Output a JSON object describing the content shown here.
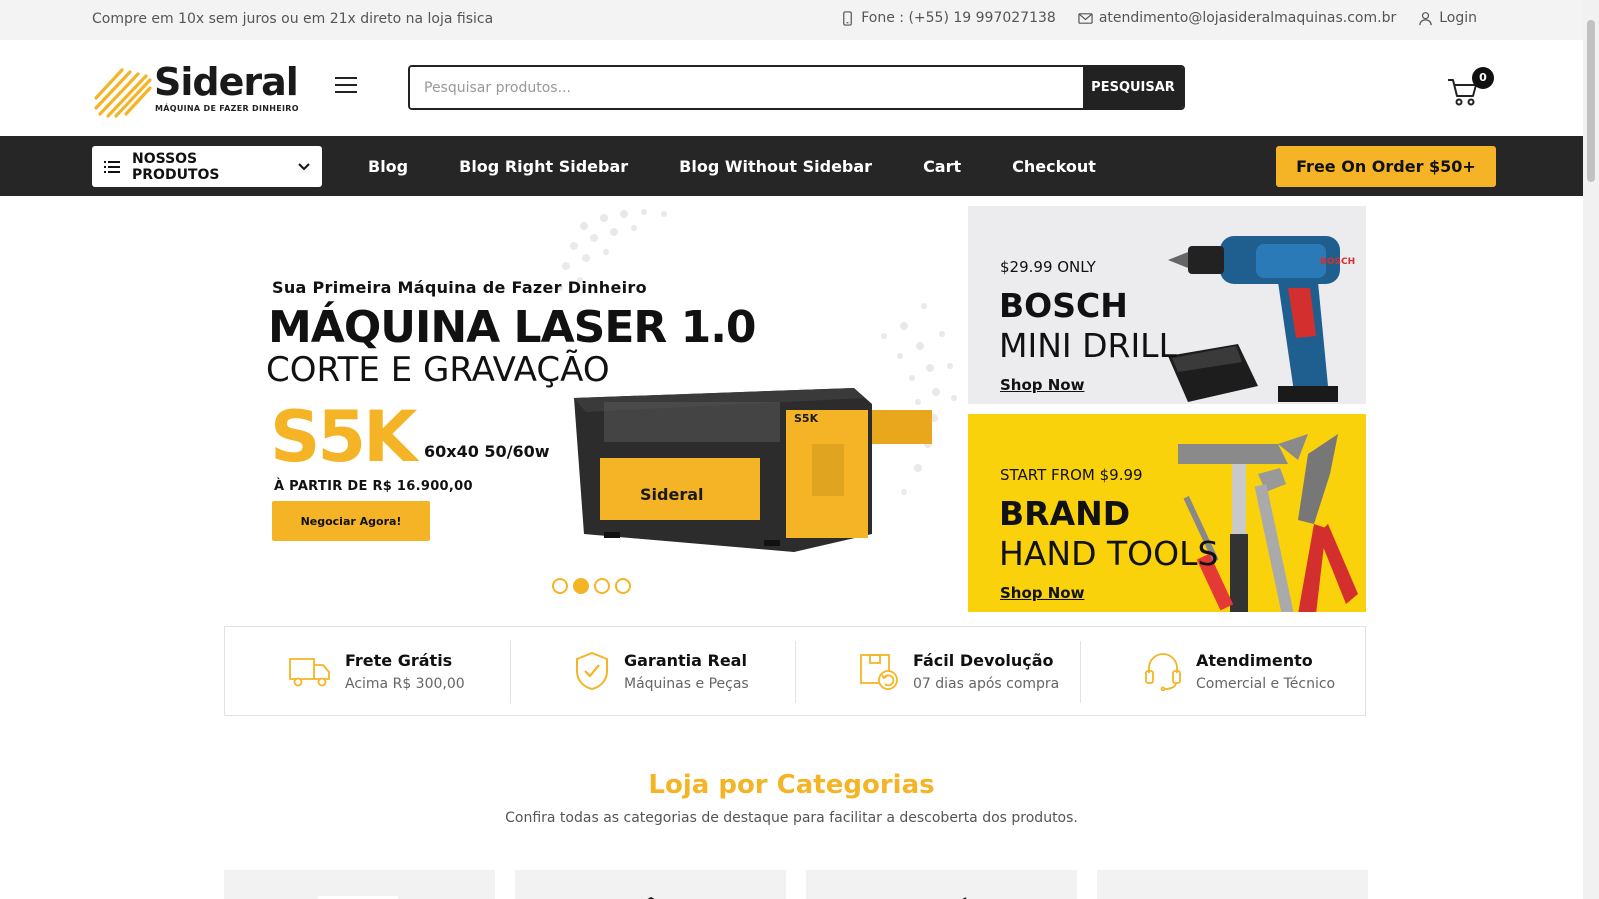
{
  "topbar": {
    "promo": "Compre em 10x sem juros ou em 21x direto na loja fisica",
    "phone": "Fone : (+55) 19 997027138",
    "email": "atendimento@lojasideralmaquinas.com.br",
    "login": "Login"
  },
  "header": {
    "logo_brand": "Sideral",
    "logo_tagline": "MÁQUINA DE FAZER DINHEIRO",
    "search_placeholder": "Pesquisar produtos...",
    "search_button": "PESQUISAR",
    "cart_count": "0"
  },
  "nav": {
    "categories_label": "NOSSOS PRODUTOS",
    "links": [
      "Blog",
      "Blog Right Sidebar",
      "Blog Without Sidebar",
      "Cart",
      "Checkout"
    ],
    "promo_button": "Free On Order $50+"
  },
  "hero": {
    "subtitle": "Sua Primeira Máquina de Fazer Dinheiro",
    "title": "MÁQUINA LASER 1.0",
    "title2": "CORTE E GRAVAÇÃO",
    "model": "S5K",
    "spec": "60x40 50/60w",
    "price": "À PARTIR DE R$ 16.900,00",
    "cta": "Negociar Agora!",
    "machine_brand": "Sideral",
    "slides": 4,
    "active_slide": 2
  },
  "banners": [
    {
      "tag": "$29.99 ONLY",
      "line1": "BOSCH",
      "line2": "MINI DRILL",
      "link": "Shop Now",
      "bg": "#ececef"
    },
    {
      "tag": "START FROM $9.99",
      "line1": "BRAND",
      "line2": "HAND TOOLS",
      "link": "Shop Now",
      "bg": "#f9d20c"
    }
  ],
  "features": [
    {
      "icon": "truck-icon",
      "title": "Frete Grátis",
      "subtitle": "Acima R$ 300,00"
    },
    {
      "icon": "shield-check-icon",
      "title": "Garantia Real",
      "subtitle": "Máquinas e Peças"
    },
    {
      "icon": "return-box-icon",
      "title": "Fácil Devolução",
      "subtitle": "07 dias após compra"
    },
    {
      "icon": "headset-icon",
      "title": "Atendimento",
      "subtitle": "Comercial e Técnico"
    }
  ],
  "categories_section": {
    "title": "Loja por Categorias",
    "description": "Confira todas as categorias de destaque para facilitar a descoberta dos produtos."
  },
  "colors": {
    "accent": "#f5b426",
    "nav_bg": "#262626",
    "banner_yellow": "#f9d20c"
  }
}
